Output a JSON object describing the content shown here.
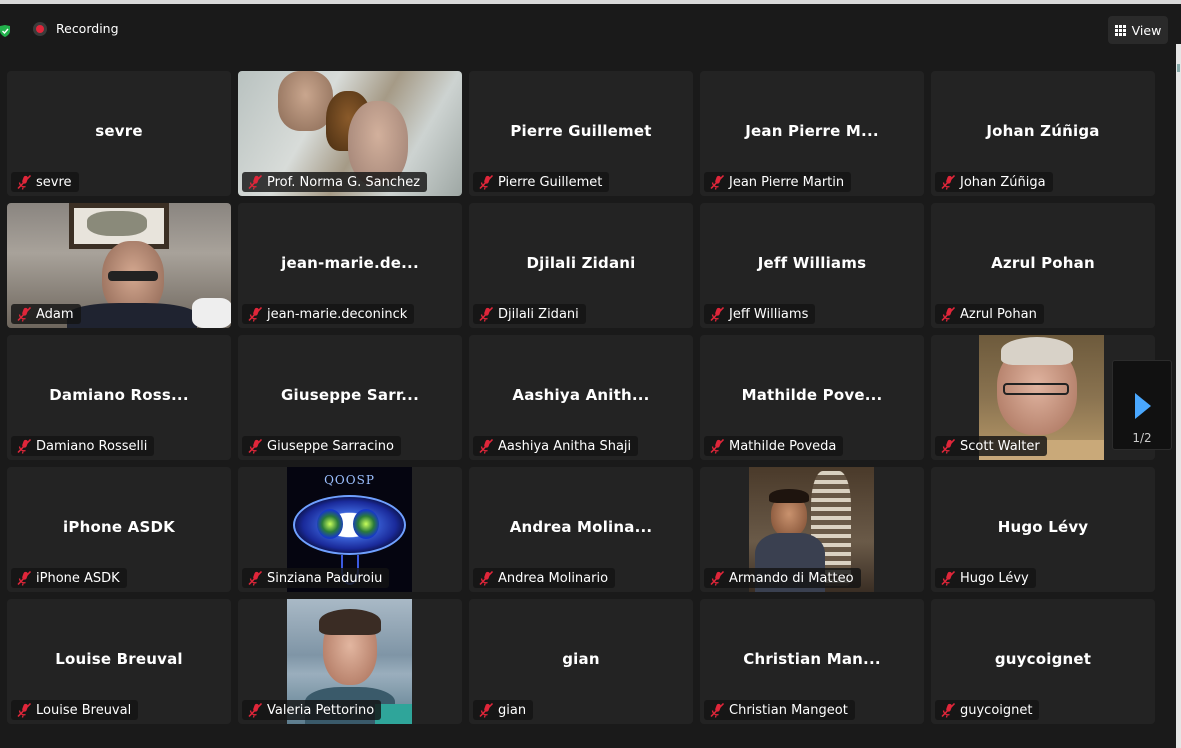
{
  "topbar": {
    "recording_label": "Recording",
    "view_label": "View"
  },
  "pager": {
    "label": "1/2"
  },
  "colors": {
    "muted_mic": "#e0263a",
    "tile_bg": "#232323",
    "recording_dot": "#e0263a",
    "pager_arrow": "#4aa8ff"
  },
  "participants": [
    {
      "display": "sevre",
      "tag": "sevre",
      "video": false
    },
    {
      "display": "",
      "tag": "Prof. Norma G. Sanchez",
      "video": true
    },
    {
      "display": "Pierre Guillemet",
      "tag": "Pierre Guillemet",
      "video": false
    },
    {
      "display": "Jean Pierre M...",
      "tag": "Jean Pierre Martin",
      "video": false
    },
    {
      "display": "Johan Zúñiga",
      "tag": "Johan Zúñiga",
      "video": false
    },
    {
      "display": "",
      "tag": "Adam",
      "video": true
    },
    {
      "display": "jean-marie.de...",
      "tag": "jean-marie.deconinck",
      "video": false
    },
    {
      "display": "Djilali Zidani",
      "tag": "Djilali Zidani",
      "video": false
    },
    {
      "display": "Jeff Williams",
      "tag": "Jeff Williams",
      "video": false
    },
    {
      "display": "Azrul Pohan",
      "tag": "Azrul Pohan",
      "video": false
    },
    {
      "display": "Damiano Ross...",
      "tag": "Damiano Rosselli",
      "video": false
    },
    {
      "display": "Giuseppe Sarr...",
      "tag": "Giuseppe Sarracino",
      "video": false
    },
    {
      "display": "Aashiya Anith...",
      "tag": "Aashiya Anitha Shaji",
      "video": false
    },
    {
      "display": "Mathilde Pove...",
      "tag": "Mathilde Poveda",
      "video": false
    },
    {
      "display": "",
      "tag": "Scott Walter",
      "video": true
    },
    {
      "display": "iPhone ASDK",
      "tag": "iPhone ASDK",
      "video": false
    },
    {
      "display": "",
      "tag": "Sinziana Paduroiu",
      "video": true,
      "logo_text": "QOOSP"
    },
    {
      "display": "Andrea Molina...",
      "tag": "Andrea Molinario",
      "video": false
    },
    {
      "display": "",
      "tag": "Armando di Matteo",
      "video": true
    },
    {
      "display": "Hugo Lévy",
      "tag": "Hugo Lévy",
      "video": false
    },
    {
      "display": "Louise Breuval",
      "tag": "Louise Breuval",
      "video": false
    },
    {
      "display": "",
      "tag": "Valeria Pettorino",
      "video": true
    },
    {
      "display": "gian",
      "tag": "gian",
      "video": false
    },
    {
      "display": "Christian Man...",
      "tag": "Christian Mangeot",
      "video": false
    },
    {
      "display": "guycoignet",
      "tag": "guycoignet",
      "video": false
    }
  ]
}
